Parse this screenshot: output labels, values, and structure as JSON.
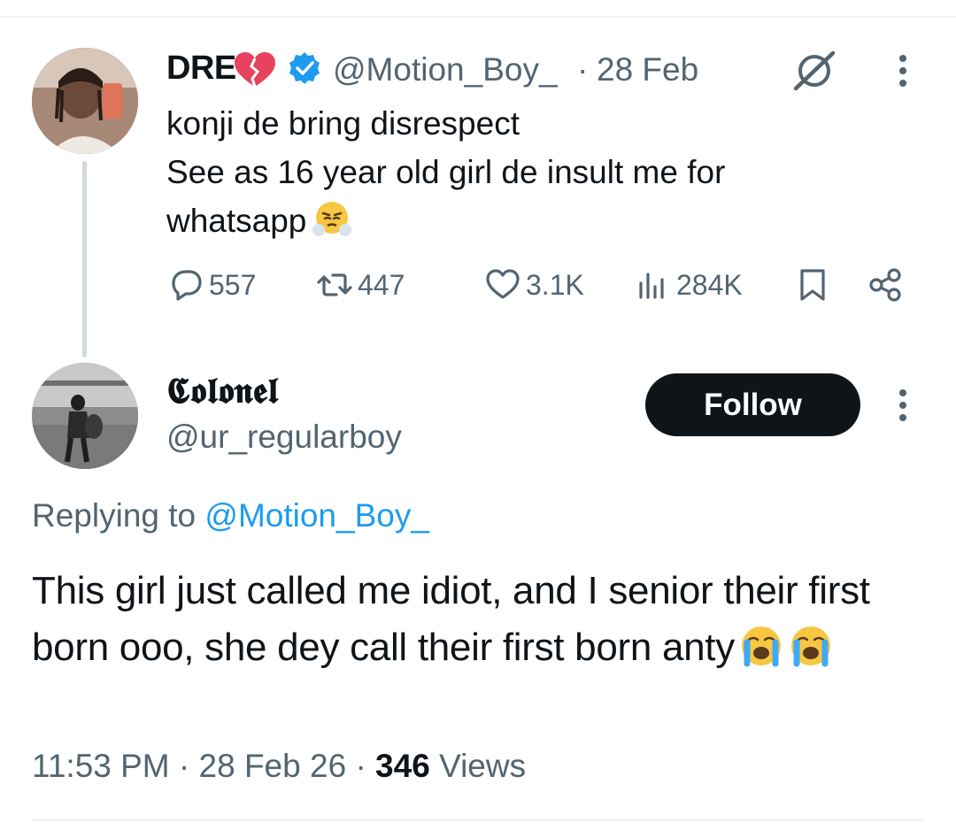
{
  "main_tweet": {
    "author_name": "DRE",
    "name_emoji": "broken-heart-emoji",
    "verified_icon": "verified-badge-icon",
    "handle": "@Motion_Boy_",
    "separator": "·",
    "date": "28 Feb",
    "text": "konji de bring disrespect\nSee as 16 year old girl de insult me for\nwhatsapp",
    "text_emoji": "face-with-steam-emoji",
    "actions": {
      "replies": "557",
      "retweets": "447",
      "likes": "3.1K",
      "views": "284K"
    }
  },
  "reply_tweet": {
    "author_name": "𝕮𝖔𝖑𝖔𝖓𝖊𝖑",
    "handle": "@ur_regularboy",
    "follow_label": "Follow",
    "replying_prefix": "Replying to",
    "replying_mention": "@Motion_Boy_",
    "text": "This girl just called me idiot, and I senior their first born ooo, she dey call their first born anty",
    "text_emojis": [
      "loudly-crying-emoji",
      "loudly-crying-emoji"
    ],
    "time": "11:53 PM",
    "date": "28 Feb 26",
    "views_count": "346",
    "views_label": "Views",
    "separator": "·"
  },
  "colors": {
    "text_primary": "#0f1419",
    "text_secondary": "#536471",
    "accent_blue": "#1d9bf0",
    "thread_line": "#cfd9de",
    "follow_bg": "#0f1419"
  }
}
